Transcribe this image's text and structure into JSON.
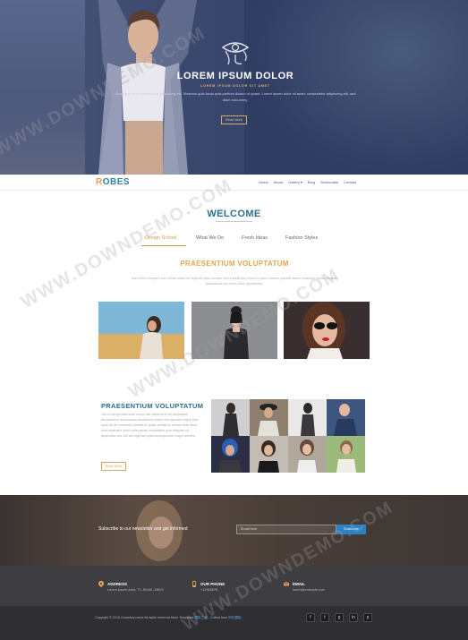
{
  "hero": {
    "title": "LOREM IPSUM DOLOR",
    "subtitle": "LOREM IPSUM DOLOR SIT AMET",
    "text": "Sit amet erat et consectetur adipiscing elit. Vivamus quis lacus quis pretium dictum ut quam. Lorem ipsum dolor sit amet, consectetur adipiscing elit, sed diam nonummy.",
    "button": "Read More"
  },
  "nav": {
    "brand_first": "R",
    "brand_rest": "OBES",
    "links": [
      "Home",
      "About",
      "Gallery ▾",
      "Blog",
      "Shortcodes",
      "Contact"
    ]
  },
  "welcome": {
    "title": "WELCOME",
    "tabs": [
      "Design School",
      "What We Do",
      "Fresh Ideas",
      "Fashion Styles"
    ],
    "section_title": "PRAESENTIUM VOLUPTATUM",
    "section_text": "Nam libero tempore cum soluta nobis est eligendi optio cumque nihil impedit quo minus id quod maxime placeat facere possimus omnis voluptas assumenda est omnis dolor repellendus."
  },
  "second": {
    "title": "PRAESENTIUM VOLUPTATUM",
    "text": "Sed ut perspiciatis unde omnis iste natus error sit voluptatem accusantium doloremque laudantium totam rem aperiam eaque ipsa quae ab illo inventore veritatis et quasi architecto beatae vitae dicta sunt explicabo nemo enim ipsam voluptatem quia voluptas sit aspernatur aut odit aut fugit sed quia consequuntur magni dolores.",
    "button": "Read More"
  },
  "newsletter": {
    "label": "Subscribe to our newsletter and get informed",
    "placeholder": "Email here",
    "button": "Subscribe"
  },
  "contact": {
    "address_title": "ADDRESS",
    "address_value": "Lorem ipsum dolor, 71, 80160, 48679",
    "phone_title": "OUR PHONE",
    "phone_value": "+12345678",
    "email_title": "EMAIL",
    "email_value": "lorem@example.com"
  },
  "footer": {
    "copyright": "Copyright © 2016 Company name All rights reserved.More Templates",
    "link1": "模板之家",
    "middle": " - Collect from ",
    "link2": "网页模板",
    "socials": [
      "f",
      "t",
      "g",
      "in",
      "p"
    ]
  },
  "watermark": "WWW.DOWNDEMO.COM",
  "colors": {
    "accent_orange": "#e0a84e",
    "accent_blue": "#2e6f8e",
    "subscribe_blue": "#2a82c2"
  }
}
